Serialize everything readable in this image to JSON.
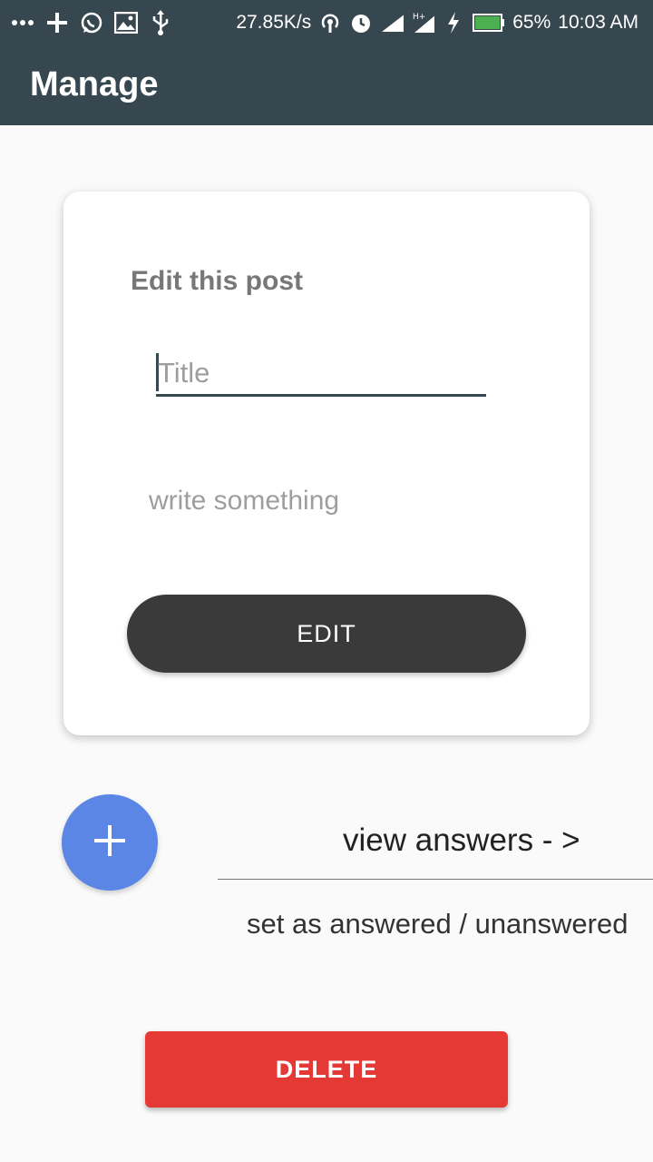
{
  "status_bar": {
    "left_icons": [
      "more-icon",
      "plus-icon",
      "whatsapp-icon",
      "image-icon",
      "usb-icon"
    ],
    "net_speed": "27.85K/s",
    "battery_pct": "65%",
    "time": "10:03 AM"
  },
  "app_bar": {
    "title": "Manage"
  },
  "card": {
    "heading": "Edit this post",
    "title_placeholder": "Title",
    "body_placeholder": "write something",
    "edit_label": "EDIT"
  },
  "actions": {
    "view_answers": "view answers - >",
    "set_answered": "set as answered / unanswered",
    "delete_label": "DELETE"
  },
  "colors": {
    "bar": "#37474f",
    "fab": "#5b86e5",
    "delete": "#e53935",
    "edit_button": "#3a3a3a"
  }
}
